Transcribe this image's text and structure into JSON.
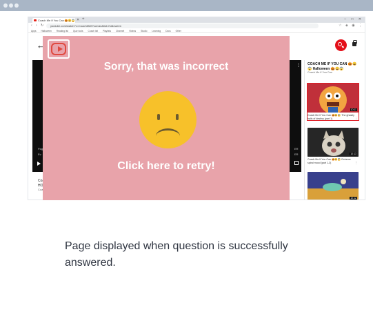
{
  "browser": {
    "tab_title": "Coach Me If You Can 🎃😀😱",
    "url": "youtube.com/watch?v=CoachMeIfYouCan&list=Halloween",
    "window_controls": "– □ ✕",
    "bookmarks": [
      "Apps",
      "Halloween",
      "Reading list",
      "Quiz tools",
      "Coach list",
      "Playlists",
      "Channel",
      "Videos",
      "Studio",
      "Learning",
      "Docs",
      "Other"
    ]
  },
  "modal": {
    "title": "Sorry, that was incorrect",
    "retry_label": "Click here to retry!",
    "bg_color": "#e8a3aa",
    "face_color": "#f7c12a"
  },
  "player": {
    "left_text_1": "Page",
    "left_text_2": "Ev",
    "right_text_1": "ER",
    "right_text_2": "ER"
  },
  "below_player": {
    "line1": "Coa",
    "line2": "HO",
    "line3": "Coa"
  },
  "sidebar": {
    "title": "COACH ME IF YOU CAN 🎃😀😱 Halloween 🎃😀😱",
    "subtitle": "Coach Me If You Can",
    "cards": [
      {
        "meta": "Coach Me If You Can 🎃😀😱 The ghastly halls of destiny (part 1)",
        "duration": "10:11"
      },
      {
        "meta": "Coach Me If You Can 🎃😀😱 Extreme spiral mood (part 1-3)",
        "duration": "10:13"
      },
      {
        "meta": "",
        "duration": "10:12"
      }
    ]
  },
  "caption": "Page displayed when question is successfully answered."
}
